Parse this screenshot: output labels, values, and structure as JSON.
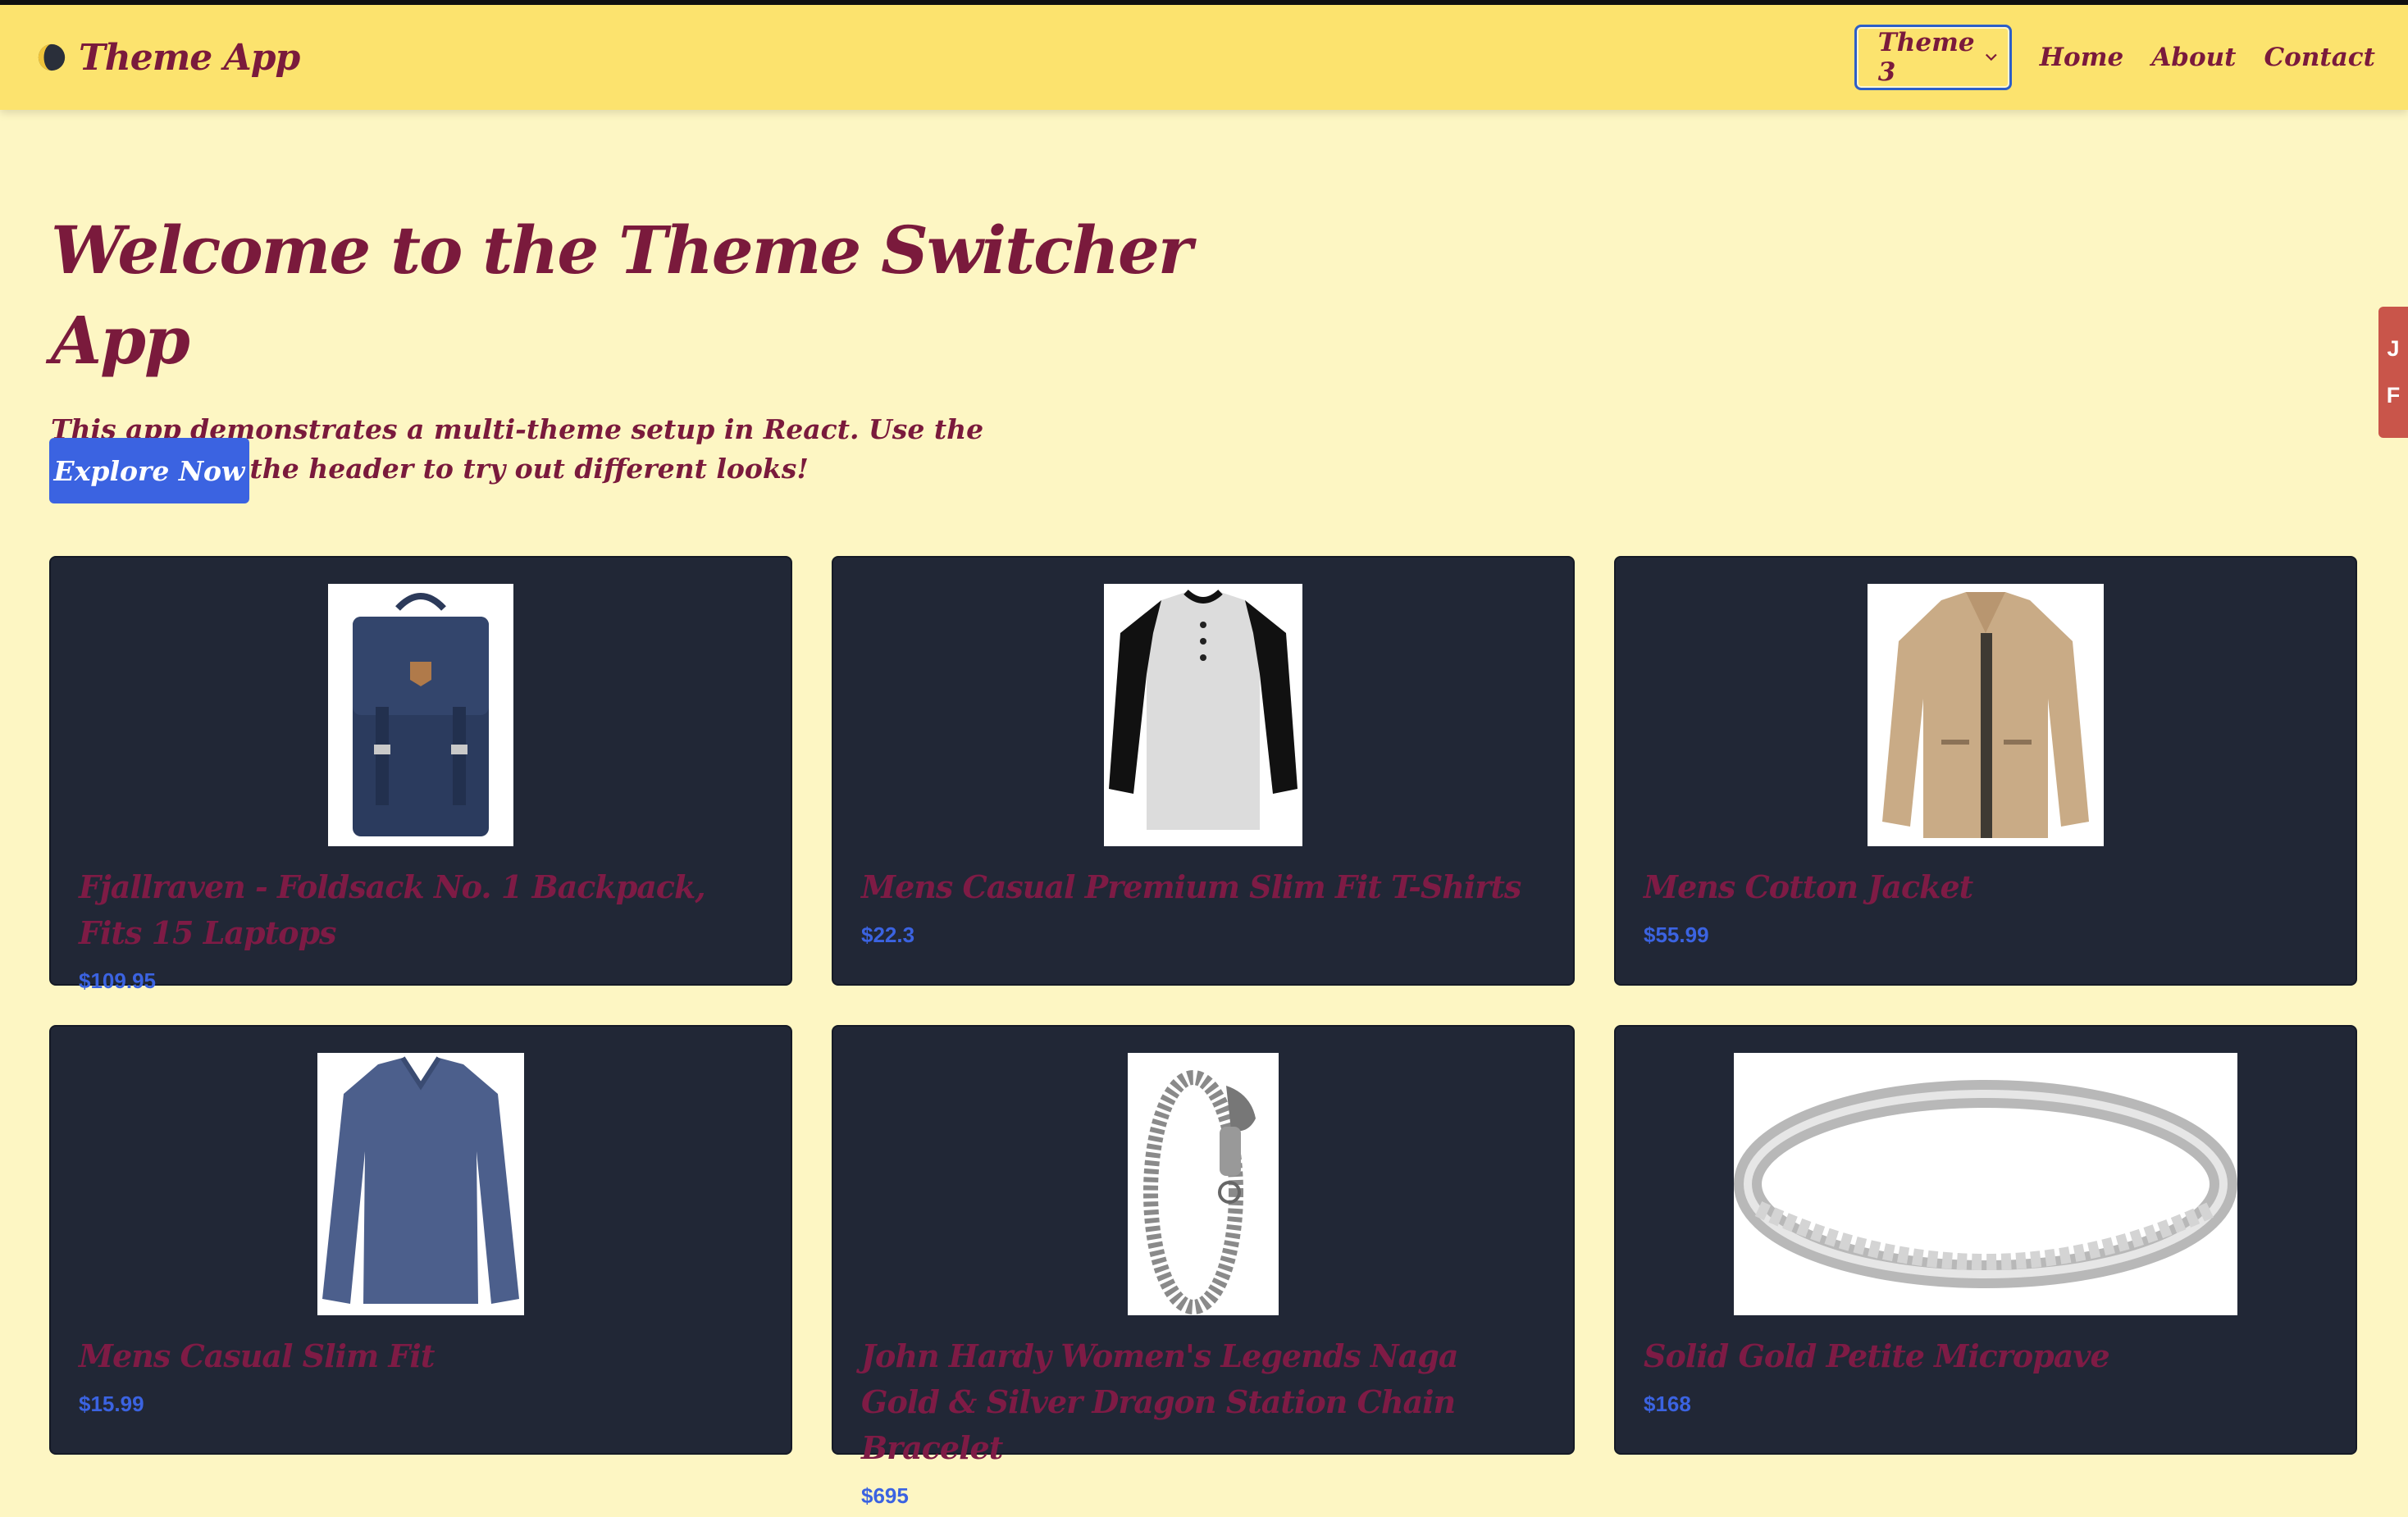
{
  "header": {
    "brand_title": "Theme App",
    "theme_select": {
      "value": "Theme 3",
      "options": [
        "Theme 3"
      ]
    },
    "nav": [
      "Home",
      "About",
      "Contact"
    ]
  },
  "hero": {
    "title": "Welcome to the Theme Switcher App",
    "description": "This app demonstrates a multi-theme setup in React. Use the dropdown in the header to try out different looks!",
    "cta_label": "Explore Now"
  },
  "side_tab": [
    "J",
    "F"
  ],
  "products": [
    {
      "title": "Fjallraven - Foldsack No. 1 Backpack, Fits 15 Laptops",
      "price": "$109.95",
      "image": "backpack"
    },
    {
      "title": "Mens Casual Premium Slim Fit T-Shirts",
      "price": "$22.3",
      "image": "tshirt"
    },
    {
      "title": "Mens Cotton Jacket",
      "price": "$55.99",
      "image": "jacket"
    },
    {
      "title": "Mens Casual Slim Fit",
      "price": "$15.99",
      "image": "longsleeve"
    },
    {
      "title": "John Hardy Women's Legends Naga Gold & Silver Dragon Station Chain Bracelet",
      "price": "$695",
      "image": "bracelet"
    },
    {
      "title": "Solid Gold Petite Micropave",
      "price": "$168",
      "image": "ring"
    }
  ],
  "colors": {
    "page_bg": "#fdf6c3",
    "header_bg": "#fce36e",
    "text_primary": "#7a1a3c",
    "accent_blue": "#3b63e1",
    "card_bg": "#212736",
    "side_tab": "#c9554a"
  }
}
